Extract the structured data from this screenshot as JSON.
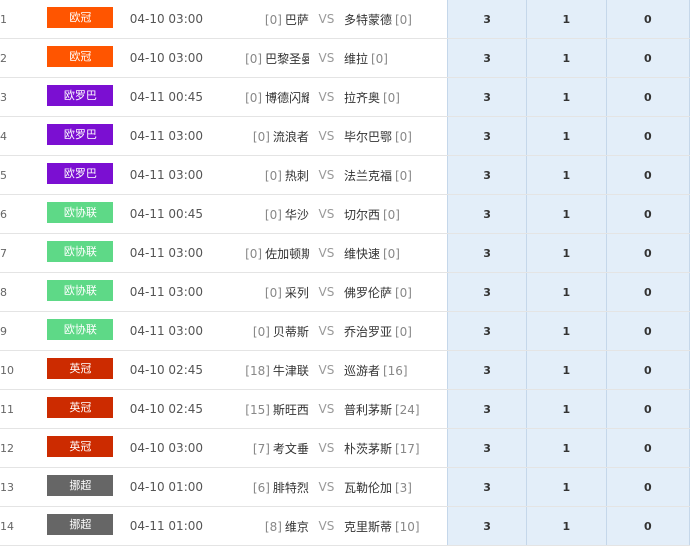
{
  "colors": {
    "欧冠": "#ff5500",
    "欧罗巴": "#7b0fd2",
    "欧协联": "#5ed987",
    "英冠": "#cc2b00",
    "挪超": "#666666",
    "odds_bg": "#e3eef9"
  },
  "matches": [
    {
      "index": "1",
      "league": "欧冠",
      "time": "04-10 03:00",
      "home_rank": "[0]",
      "home": "巴萨",
      "vs": "VS",
      "away": "多特蒙德",
      "away_rank": "[0]",
      "odds": [
        "3",
        "1",
        "0"
      ]
    },
    {
      "index": "2",
      "league": "欧冠",
      "time": "04-10 03:00",
      "home_rank": "[0]",
      "home": "巴黎圣曼",
      "vs": "VS",
      "away": "维拉",
      "away_rank": "[0]",
      "odds": [
        "3",
        "1",
        "0"
      ]
    },
    {
      "index": "3",
      "league": "欧罗巴",
      "time": "04-11 00:45",
      "home_rank": "[0]",
      "home": "博德闪耀",
      "vs": "VS",
      "away": "拉齐奥",
      "away_rank": "[0]",
      "odds": [
        "3",
        "1",
        "0"
      ]
    },
    {
      "index": "4",
      "league": "欧罗巴",
      "time": "04-11 03:00",
      "home_rank": "[0]",
      "home": "流浪者",
      "vs": "VS",
      "away": "毕尔巴鄂",
      "away_rank": "[0]",
      "odds": [
        "3",
        "1",
        "0"
      ]
    },
    {
      "index": "5",
      "league": "欧罗巴",
      "time": "04-11 03:00",
      "home_rank": "[0]",
      "home": "热刺",
      "vs": "VS",
      "away": "法兰克福",
      "away_rank": "[0]",
      "odds": [
        "3",
        "1",
        "0"
      ]
    },
    {
      "index": "6",
      "league": "欧协联",
      "time": "04-11 00:45",
      "home_rank": "[0]",
      "home": "华沙",
      "vs": "VS",
      "away": "切尔西",
      "away_rank": "[0]",
      "odds": [
        "3",
        "1",
        "0"
      ]
    },
    {
      "index": "7",
      "league": "欧协联",
      "time": "04-11 03:00",
      "home_rank": "[0]",
      "home": "佐加顿斯",
      "vs": "VS",
      "away": "维快速",
      "away_rank": "[0]",
      "odds": [
        "3",
        "1",
        "0"
      ]
    },
    {
      "index": "8",
      "league": "欧协联",
      "time": "04-11 03:00",
      "home_rank": "[0]",
      "home": "采列",
      "vs": "VS",
      "away": "佛罗伦萨",
      "away_rank": "[0]",
      "odds": [
        "3",
        "1",
        "0"
      ]
    },
    {
      "index": "9",
      "league": "欧协联",
      "time": "04-11 03:00",
      "home_rank": "[0]",
      "home": "贝蒂斯",
      "vs": "VS",
      "away": "乔治罗亚",
      "away_rank": "[0]",
      "odds": [
        "3",
        "1",
        "0"
      ]
    },
    {
      "index": "10",
      "league": "英冠",
      "time": "04-10 02:45",
      "home_rank": "[18]",
      "home": "牛津联",
      "vs": "VS",
      "away": "巡游者",
      "away_rank": "[16]",
      "odds": [
        "3",
        "1",
        "0"
      ]
    },
    {
      "index": "11",
      "league": "英冠",
      "time": "04-10 02:45",
      "home_rank": "[15]",
      "home": "斯旺西",
      "vs": "VS",
      "away": "普利茅斯",
      "away_rank": "[24]",
      "odds": [
        "3",
        "1",
        "0"
      ]
    },
    {
      "index": "12",
      "league": "英冠",
      "time": "04-10 03:00",
      "home_rank": "[7]",
      "home": "考文垂",
      "vs": "VS",
      "away": "朴茨茅斯",
      "away_rank": "[17]",
      "odds": [
        "3",
        "1",
        "0"
      ]
    },
    {
      "index": "13",
      "league": "挪超",
      "time": "04-10 01:00",
      "home_rank": "[6]",
      "home": "腓特烈",
      "vs": "VS",
      "away": "瓦勒伦加",
      "away_rank": "[3]",
      "odds": [
        "3",
        "1",
        "0"
      ]
    },
    {
      "index": "14",
      "league": "挪超",
      "time": "04-11 01:00",
      "home_rank": "[8]",
      "home": "维京",
      "vs": "VS",
      "away": "克里斯蒂",
      "away_rank": "[10]",
      "odds": [
        "3",
        "1",
        "0"
      ]
    }
  ]
}
